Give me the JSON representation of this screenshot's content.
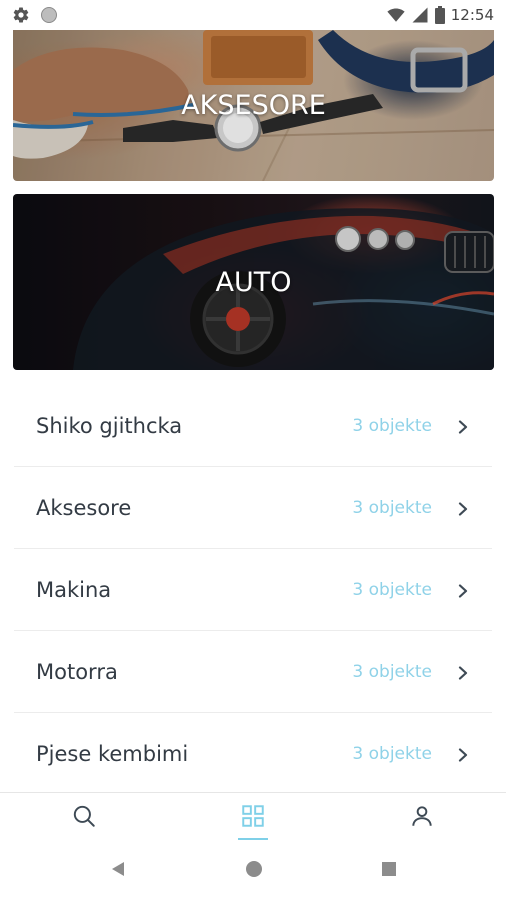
{
  "status_bar": {
    "time": "12:54",
    "left_icons": [
      "gear-icon",
      "circle-icon"
    ],
    "right_icons": [
      "wifi-icon",
      "signal-icon",
      "battery-icon"
    ]
  },
  "banners": [
    {
      "title": "AKSESORE"
    },
    {
      "title": "AUTO"
    }
  ],
  "categories": [
    {
      "label": "Shiko gjithcka",
      "count": "3 objekte"
    },
    {
      "label": "Aksesore",
      "count": "3 objekte"
    },
    {
      "label": "Makina",
      "count": "3 objekte"
    },
    {
      "label": "Motorra",
      "count": "3 objekte"
    },
    {
      "label": "Pjese kembimi",
      "count": "3 objekte"
    }
  ],
  "bottom_nav": {
    "items": [
      "search-icon",
      "grid-icon",
      "user-icon"
    ],
    "active": "grid-icon"
  },
  "system_nav": [
    "back-icon",
    "home-icon",
    "recents-icon"
  ],
  "colors": {
    "accent": "#7fd0e8",
    "count_text": "#8fd2e8",
    "label_text": "#333b44",
    "icon_dark": "#3e4a55"
  }
}
